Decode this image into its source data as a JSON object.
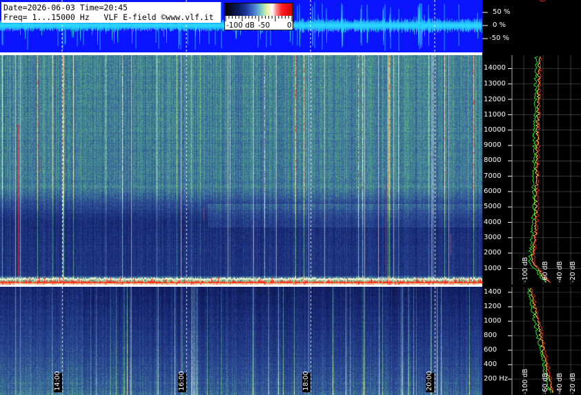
{
  "info": {
    "line1": "Date=2026-06-03 Time=20:45",
    "line2": "Freq= 1...15000 Hz   VLF E-field ©www.vlf.it"
  },
  "colorbar": {
    "labels": [
      "-100 dB",
      "-50",
      "0"
    ]
  },
  "waveform_axis": {
    "labels": [
      "50 %",
      "0 %",
      "-50 %"
    ]
  },
  "freq_axis_hi": {
    "labels": [
      "14000",
      "13000",
      "12000",
      "11000",
      "10000",
      "9000",
      "8000",
      "7000",
      "6000",
      "5000",
      "4000",
      "3000",
      "2000",
      "1000"
    ],
    "db_labels": [
      "-100 dB",
      "-60 dB",
      "-40 dB",
      "-20 dB"
    ]
  },
  "freq_axis_lo": {
    "labels": [
      "1400",
      "1200",
      "1000",
      "800",
      "600",
      "400",
      "200 Hz"
    ],
    "db_labels": [
      "-100 dB",
      "-60 dB",
      "-40 dB",
      "-20 dB"
    ]
  },
  "time_axis": {
    "labels": [
      "14:00",
      "16:00",
      "18:00",
      "20:00"
    ]
  },
  "colors": {
    "waveform_bg": "#0a14ff",
    "waveform_trace": "#2ad6ff",
    "spectrum_avg": "#ffff40",
    "spectrum_peak": "#ff2020",
    "spectrum_min": "#20ff20"
  }
}
